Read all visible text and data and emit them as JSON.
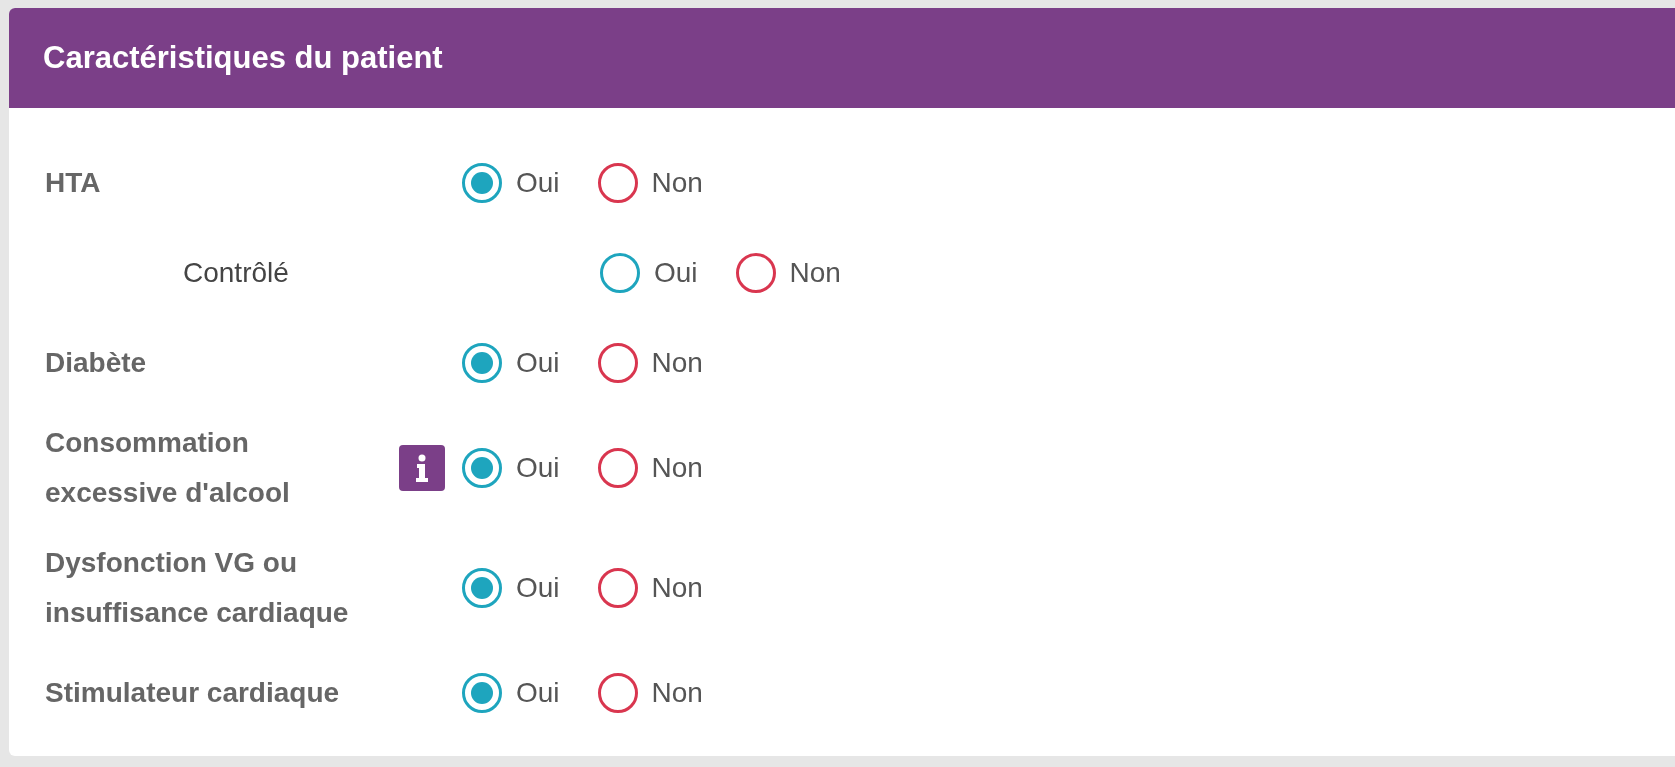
{
  "card": {
    "title": "Caractéristiques du patient"
  },
  "rows": [
    {
      "kind": "main",
      "label": "HTA",
      "info": false,
      "options": [
        {
          "label": "Oui",
          "selected": true,
          "color": "#1ea5be"
        },
        {
          "label": "Non",
          "selected": false,
          "color": "#d9364f"
        }
      ]
    },
    {
      "kind": "sub",
      "label": "Contrôlé",
      "info": false,
      "options": [
        {
          "label": "Oui",
          "selected": false,
          "color": "#1ea5be"
        },
        {
          "label": "Non",
          "selected": false,
          "color": "#d9364f"
        }
      ]
    },
    {
      "kind": "main",
      "label": "Diabète",
      "info": false,
      "options": [
        {
          "label": "Oui",
          "selected": true,
          "color": "#1ea5be"
        },
        {
          "label": "Non",
          "selected": false,
          "color": "#d9364f"
        }
      ]
    },
    {
      "kind": "main",
      "label": "Consommation excessive d'alcool",
      "info": true,
      "options": [
        {
          "label": "Oui",
          "selected": true,
          "color": "#1ea5be"
        },
        {
          "label": "Non",
          "selected": false,
          "color": "#d9364f"
        }
      ]
    },
    {
      "kind": "main",
      "label": "Dysfonction VG ou insuffisance cardiaque",
      "info": false,
      "options": [
        {
          "label": "Oui",
          "selected": true,
          "color": "#1ea5be"
        },
        {
          "label": "Non",
          "selected": false,
          "color": "#d9364f"
        }
      ]
    },
    {
      "kind": "main",
      "label": "Stimulateur cardiaque",
      "info": false,
      "options": [
        {
          "label": "Oui",
          "selected": true,
          "color": "#1ea5be"
        },
        {
          "label": "Non",
          "selected": false,
          "color": "#d9364f"
        }
      ]
    }
  ]
}
